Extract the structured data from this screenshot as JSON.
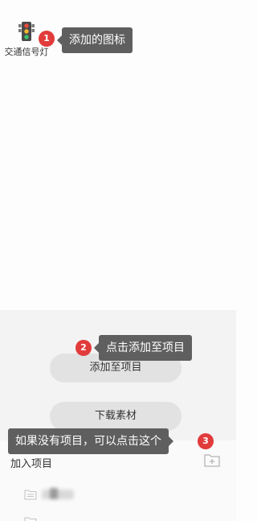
{
  "icons": [
    {
      "name": "交通信号灯",
      "icon": "traffic-light-icon"
    }
  ],
  "actions": {
    "add_to_project_label": "添加至项目",
    "download_label": "下载素材"
  },
  "projects": {
    "title": "加入项目",
    "add_icon": "add-folder-icon"
  },
  "guides": [
    {
      "number": "1",
      "text": "添加的图标"
    },
    {
      "number": "2",
      "text": "点击添加至项目"
    },
    {
      "number": "3",
      "text": "如果没有项目，可以点击这个"
    }
  ],
  "colors": {
    "badge": "#e23b3b",
    "tooltip_bg": "#5f5f5f",
    "pill_bg": "#e2e2e2"
  }
}
